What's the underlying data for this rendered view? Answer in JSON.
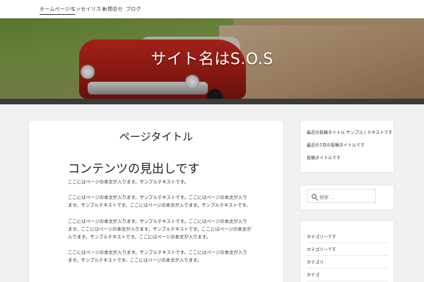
{
  "nav": {
    "items": [
      "ホームページへ",
      "エッセイリスト",
      "お問合せ",
      "ブログ"
    ]
  },
  "header": {
    "site_title": "サイト名はS.O.S"
  },
  "colors": {
    "page_bg": "#f1f1f1",
    "band": "#3b3b3b",
    "car_red": "#c52a1f"
  },
  "main": {
    "post_title": "ページタイトル",
    "section_heading": "コンテンツの見出しです",
    "paragraphs": [
      "ここにはページの本文が入ります。サンプルテキストです。",
      "ここにはページの本文が入ります。サンプルテキストです。ここにはページの本文が入ります。サンプルテキストです。ここにはページの本文が入ります。サンプルテキストです。",
      "ここにはページの本文が入ります。サンプルテキストです。ここにはページの本文が入ります。ここにはページの本文が入ります。サンプルテキストです。ここにはページの本文が入ります。サンプルテキストです。ここにはページの本文が入ります。",
      "ここにはページの本文が入ります。サンプルテキストです。ここにはページの本文が入ります。サンプルテキストです。ここにはページの本文が入ります。"
    ]
  },
  "sidebar": {
    "recent_posts": [
      "最近の投稿タイトル サンプル | テキストです",
      "最近の7月の投稿タイトルです",
      "投稿タイトルです"
    ],
    "search": {
      "icon": "search-icon",
      "placeholder": "検索 …"
    },
    "categories": [
      "カテゴリーです",
      "カテゴリーです",
      "カテゴリ",
      "カテゴ"
    ]
  }
}
